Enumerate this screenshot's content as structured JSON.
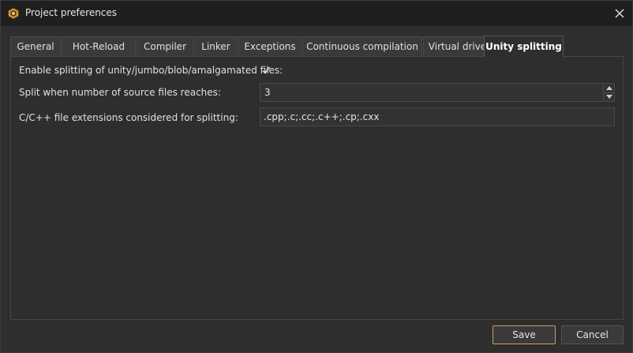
{
  "window": {
    "title": "Project preferences",
    "app_icon": "hexagon-app-icon",
    "close_icon": "close-icon"
  },
  "tabs": [
    {
      "label": "General",
      "active": false
    },
    {
      "label": "Hot-Reload",
      "active": false
    },
    {
      "label": "Compiler",
      "active": false
    },
    {
      "label": "Linker",
      "active": false
    },
    {
      "label": "Exceptions",
      "active": false
    },
    {
      "label": "Continuous compilation",
      "active": false
    },
    {
      "label": "Virtual drive",
      "active": false
    },
    {
      "label": "Unity splitting",
      "active": true
    }
  ],
  "settings": {
    "enable_label": "Enable splitting of unity/jumbo/blob/amalgamated files:",
    "enable_checked": true,
    "threshold_label": "Split when number of source files reaches:",
    "threshold_value": "3",
    "extensions_label": "C/C++ file extensions considered for splitting:",
    "extensions_value": ".cpp;.c;.cc;.c++;.cp;.cxx"
  },
  "buttons": {
    "save": "Save",
    "cancel": "Cancel"
  },
  "colors": {
    "accent": "#c9a25e",
    "background": "#2e2e2e",
    "titlebar": "#1f1f1f"
  }
}
